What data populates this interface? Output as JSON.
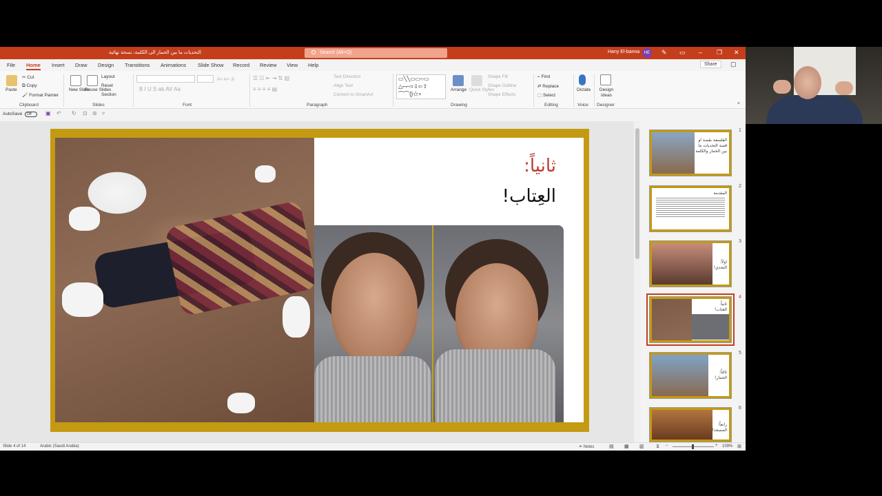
{
  "titlebar": {
    "doc_title": "التحديات ما بين الحمار الى الكلمة، نسخة نهائية",
    "search_placeholder": "Search (Alt+Q)",
    "user_name": "Hany El-banna",
    "user_initials": "HE"
  },
  "menu": {
    "tabs": [
      "File",
      "Home",
      "Insert",
      "Draw",
      "Design",
      "Transitions",
      "Animations",
      "Slide Show",
      "Record",
      "Review",
      "View",
      "Help"
    ],
    "active": "Home",
    "share_label": "Share"
  },
  "ribbon": {
    "clipboard": {
      "paste": "Paste",
      "cut": "Cut",
      "copy": "Copy",
      "format_painter": "Format Painter",
      "label": "Clipboard"
    },
    "slides": {
      "new_slide": "New Slide",
      "reuse_slides": "Reuse Slides",
      "layout": "Layout",
      "reset": "Reset",
      "section": "Section",
      "label": "Slides"
    },
    "font": {
      "label": "Font"
    },
    "paragraph": {
      "text_direction": "Text Direction",
      "align_text": "Align Text",
      "convert_smartart": "Convert to SmartArt",
      "label": "Paragraph"
    },
    "drawing": {
      "arrange": "Arrange",
      "quick_styles": "Quick Styles",
      "shape_fill": "Shape Fill",
      "shape_outline": "Shape Outline",
      "shape_effects": "Shape Effects",
      "label": "Drawing"
    },
    "editing": {
      "find": "Find",
      "replace": "Replace",
      "select": "Select",
      "label": "Editing"
    },
    "voice": {
      "dictate": "Dictate",
      "label": "Voice"
    },
    "designer": {
      "design_ideas": "Design Ideas",
      "label": "Designer"
    }
  },
  "qat": {
    "autosave": "AutoSave",
    "toggle": "Off"
  },
  "slide": {
    "heading_line1": "ثانياً:",
    "heading_line2": "العِتاب!"
  },
  "thumbnails": [
    {
      "num": "1",
      "text": "الفلسفة بقصة او قصة التحديات ما بين الحمار والكلمة"
    },
    {
      "num": "2",
      "text": "المقدمة"
    },
    {
      "num": "3",
      "text": "اولاً: التحدي!"
    },
    {
      "num": "4",
      "text": "ثانياً: العتاب!"
    },
    {
      "num": "5",
      "text": "ثالثاً: الحمار!"
    },
    {
      "num": "6",
      "text": "رابعاً: المسجد!"
    }
  ],
  "status": {
    "slide_count": "Slide 4 of 14",
    "language": "Arabic (Saudi Arabia)",
    "notes": "Notes",
    "zoom": "109%"
  },
  "colors": {
    "accent": "#c43e1c",
    "slide_border": "#c49a12",
    "heading_red": "#c0392b"
  }
}
